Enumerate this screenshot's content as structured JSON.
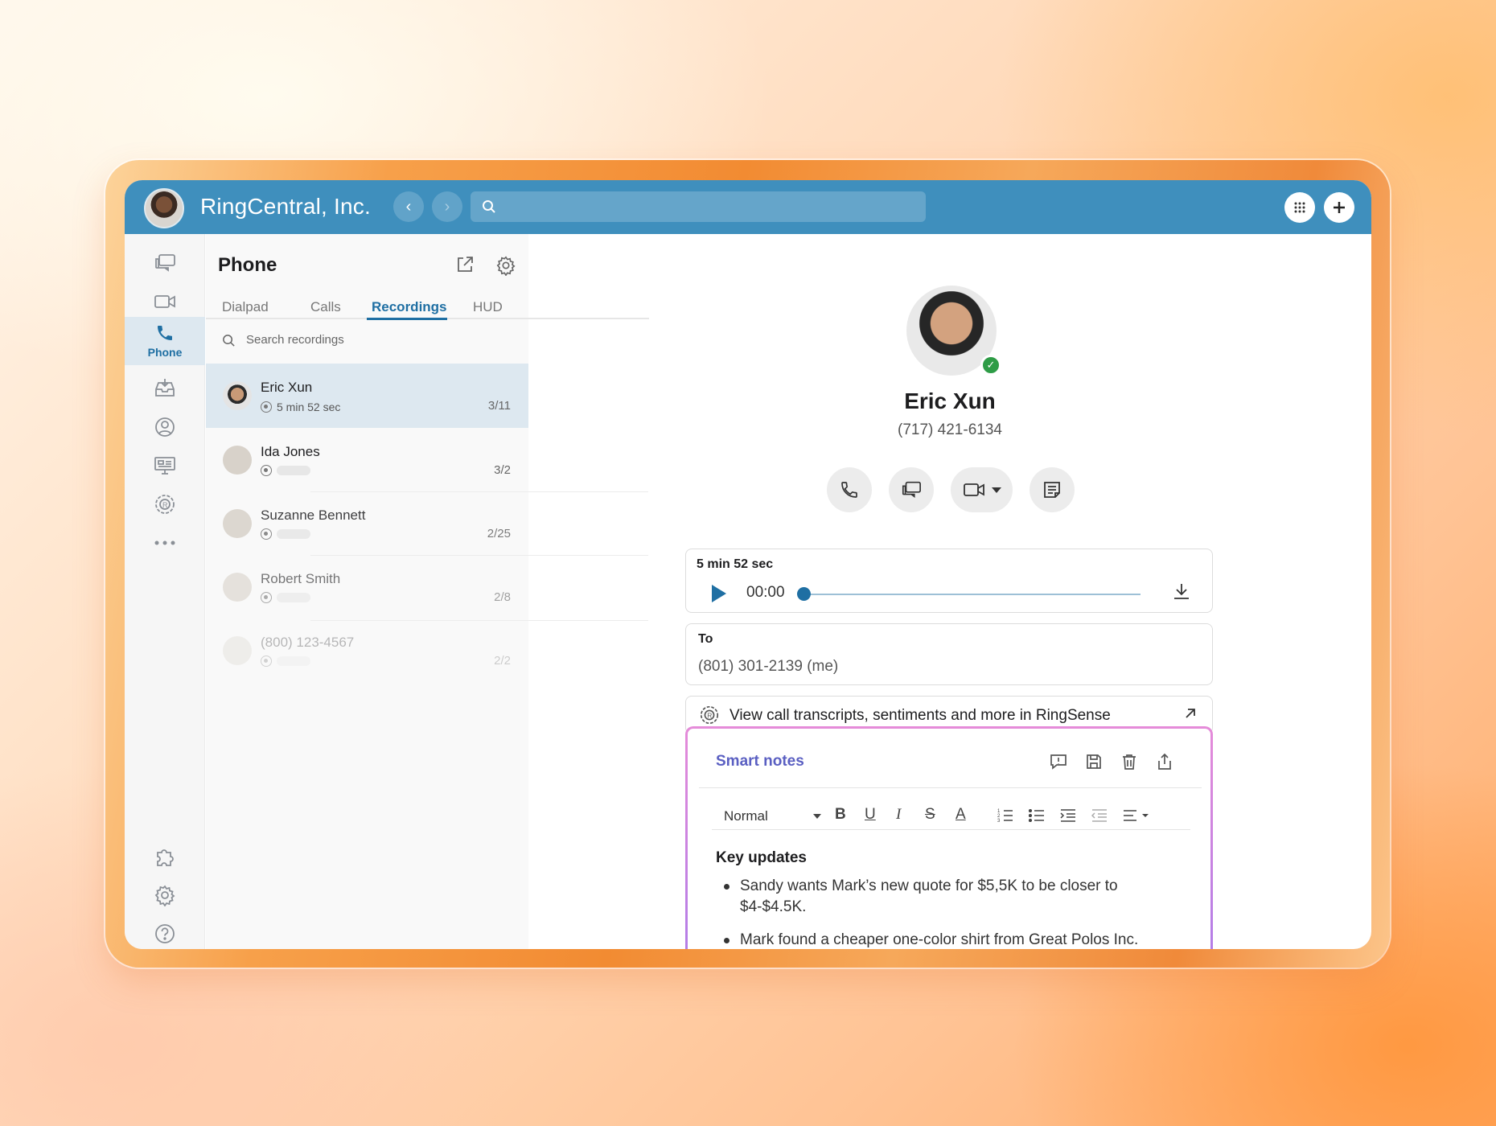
{
  "header": {
    "title": "RingCentral, Inc.",
    "back_icon": "chevron-left-icon",
    "forward_icon": "chevron-right-icon",
    "search_icon": "search-icon"
  },
  "rail": {
    "items": [
      {
        "name": "messages",
        "icon": "chat-bubbles-icon"
      },
      {
        "name": "video",
        "icon": "video-camera-icon"
      },
      {
        "name": "phone",
        "icon": "phone-icon",
        "label": "Phone",
        "active": true
      },
      {
        "name": "inbox",
        "icon": "inbox-tray-icon"
      },
      {
        "name": "contacts",
        "icon": "contact-icon"
      },
      {
        "name": "rooms",
        "icon": "monitor-icon"
      },
      {
        "name": "ringsense",
        "icon": "ringsense-icon"
      },
      {
        "name": "more",
        "icon": "more-dots-icon"
      }
    ],
    "bottom": [
      "puzzle-icon",
      "gear-icon",
      "help-icon"
    ]
  },
  "phone_panel": {
    "title": "Phone",
    "tabs": [
      "Dialpad",
      "Calls",
      "Recordings",
      "HUD"
    ],
    "active_tab": "Recordings",
    "search_placeholder": "Search recordings",
    "recordings": [
      {
        "name": "Eric Xun",
        "duration": "5 min 52 sec",
        "date": "3/11"
      },
      {
        "name": "Ida Jones",
        "duration": "",
        "date": "3/2"
      },
      {
        "name": "Suzanne Bennett",
        "duration": "",
        "date": "2/25"
      },
      {
        "name": "Robert Smith",
        "duration": "",
        "date": "2/8"
      },
      {
        "name": "(800) 123-4567",
        "duration": "",
        "date": "2/2"
      }
    ]
  },
  "contact": {
    "name": "Eric Xun",
    "phone": "(717) 421-6134",
    "status_color": "#2e9c46"
  },
  "player": {
    "duration": "5 min 52 sec",
    "current_time": "00:00",
    "progress": 0
  },
  "to": {
    "label": "To",
    "value": "(801) 301-2139 (me)"
  },
  "ringsense": {
    "text": "View call transcripts, sentiments and more in RingSense"
  },
  "smart_notes": {
    "title": "Smart notes",
    "format_select": "Normal",
    "heading": "Key updates",
    "bullets": [
      "Sandy wants Mark’s new quote for $5,5K to be closer to $4-$4.5K.",
      "Mark found a cheaper one-color shirt from Great Polos Inc."
    ]
  },
  "colors": {
    "brand_blue": "#3f8fbd",
    "accent": "#1f6fa3",
    "notes_title": "#5a5fc2"
  }
}
